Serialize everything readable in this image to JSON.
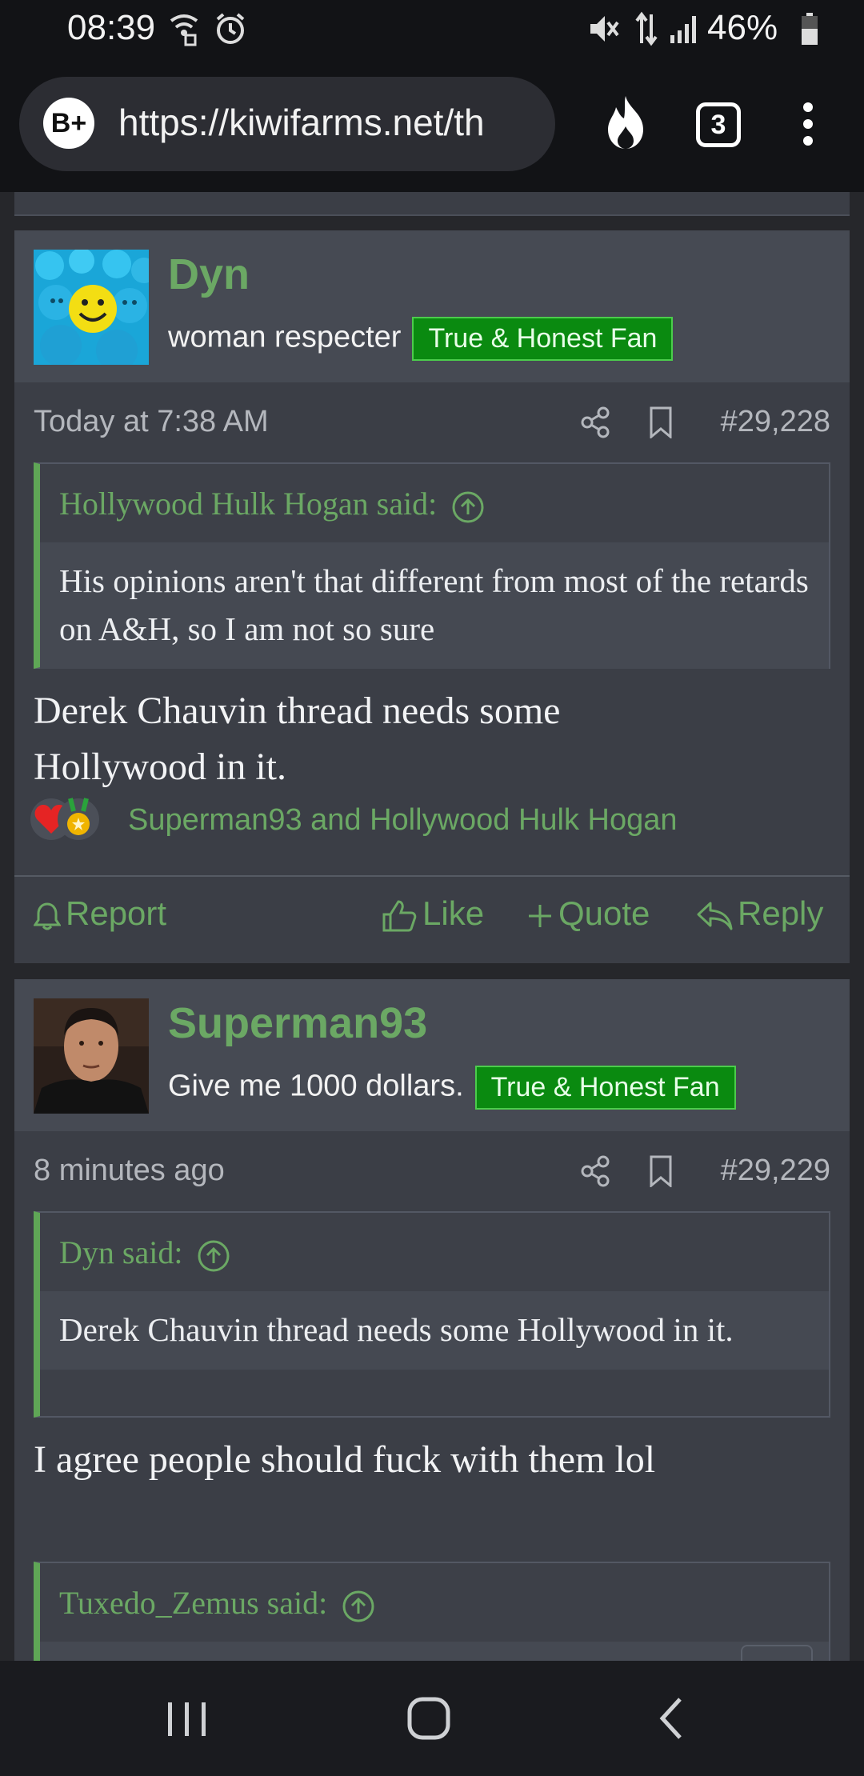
{
  "status_bar": {
    "time": "08:39",
    "battery": "46%"
  },
  "browser": {
    "url": "https://kiwifarms.net/th",
    "tab_count": "3"
  },
  "posts": [
    {
      "username": "Dyn",
      "user_title": "woman respecter",
      "badge": "True & Honest Fan",
      "time": "Today at 7:38 AM",
      "post_number": "#29,228",
      "quote_author": "Hollywood Hulk Hogan said:",
      "quote_text": "His opinions aren't that different from most of the retards on A&H, so I am not so sure",
      "body_line1": "Derek Chauvin thread needs some",
      "body_line2": "Hollywood in it.",
      "reactions": "Superman93 and Hollywood Hulk Hogan",
      "actions": {
        "report": "Report",
        "like": "Like",
        "quote": "Quote",
        "reply": "Reply"
      }
    },
    {
      "username": "Superman93",
      "user_title": "Give me 1000 dollars.",
      "badge": "True & Honest Fan",
      "time": "8 minutes ago",
      "post_number": "#29,229",
      "quote_author": "Dyn said:",
      "quote_text": "Derek Chauvin thread needs some Hollywood in it.",
      "body": "I agree people should fuck with them lol",
      "quote2_author": "Tuxedo_Zemus said:"
    }
  ],
  "colors": {
    "accent_green": "#6ba864",
    "badge_green": "#0a8a10",
    "post_bg": "#3b3e46"
  }
}
